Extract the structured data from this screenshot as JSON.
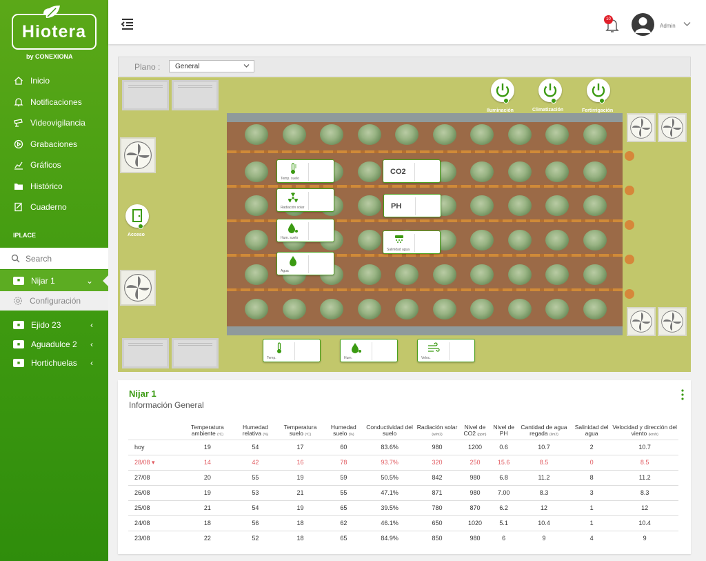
{
  "app": {
    "brand": "Hiotera",
    "byline": "by CONEXIONA"
  },
  "sidebar": {
    "nav": [
      {
        "label": "Inicio",
        "icon": "home-icon"
      },
      {
        "label": "Notificaciones",
        "icon": "bell-icon"
      },
      {
        "label": "Videovigilancia",
        "icon": "camera-icon"
      },
      {
        "label": "Grabaciones",
        "icon": "play-circle-icon"
      },
      {
        "label": "Gráficos",
        "icon": "chart-icon"
      },
      {
        "label": "Histórico",
        "icon": "folder-icon"
      },
      {
        "label": "Cuaderno",
        "icon": "notebook-icon"
      }
    ],
    "section_label": "IPLACE",
    "search_placeholder": "Search",
    "places": [
      {
        "label": "Nijar 1",
        "expanded": true
      },
      {
        "label": "Ejido 23"
      },
      {
        "label": "Aguadulce 2"
      },
      {
        "label": "Hortichuelas"
      }
    ],
    "sub_item": "Configuración"
  },
  "header": {
    "notifications_count": "10",
    "user": "Admin"
  },
  "plan": {
    "label": "Plano :",
    "selected": "General"
  },
  "greenhouse": {
    "power_buttons": [
      {
        "label": "Iluminación"
      },
      {
        "label": "Climatización"
      },
      {
        "label": "Fertirrigación"
      }
    ],
    "access_label": "Acceso",
    "sensors": [
      {
        "label": "Temp. suelo",
        "icon": "thermometer-icon"
      },
      {
        "label": "Radiación solar",
        "icon": "radiation-icon"
      },
      {
        "label": "Hum. suelo",
        "icon": "drop-icon"
      },
      {
        "label": "Agua",
        "icon": "drop-icon"
      },
      {
        "label": "CO2"
      },
      {
        "label": "PH"
      },
      {
        "label": "Salinidad agua",
        "icon": "salinity-icon"
      },
      {
        "label": "Temp.",
        "icon": "thermometer-icon"
      },
      {
        "label": "Hum.",
        "icon": "drop-icon"
      },
      {
        "label": "Veloc.",
        "icon": "wind-icon"
      }
    ],
    "colors": {
      "accent": "#3b9a12",
      "alert": "#e0585e"
    }
  },
  "card": {
    "title": "Nijar 1",
    "subtitle": "Información General",
    "columns": [
      {
        "label": "Temperatura ambiente",
        "unit": "(ºC)"
      },
      {
        "label": "Humedad relativa",
        "unit": "(%)"
      },
      {
        "label": "Temperatura suelo",
        "unit": "(ºC)"
      },
      {
        "label": "Humedad suelo",
        "unit": "(%)"
      },
      {
        "label": "Conductividad del suelo",
        "unit": ""
      },
      {
        "label": "Radiación solar",
        "unit": "(w/m2)"
      },
      {
        "label": "Nivel de CO2",
        "unit": "(ppm)"
      },
      {
        "label": "Nivel de PH",
        "unit": ""
      },
      {
        "label": "Cantidad de agua regada",
        "unit": "(l/m2)"
      },
      {
        "label": "Salinidad del agua",
        "unit": ""
      },
      {
        "label": "Velocidad y dirección del viento",
        "unit": "(km/h)"
      }
    ],
    "rows": [
      {
        "date": "hoy",
        "alert": false,
        "values": [
          "19",
          "54",
          "17",
          "60",
          "83.6%",
          "980",
          "1200",
          "0.6",
          "10.7",
          "2",
          "10.7"
        ]
      },
      {
        "date": "28/08",
        "alert": true,
        "values": [
          "14",
          "42",
          "16",
          "78",
          "93.7%",
          "320",
          "250",
          "15.6",
          "8.5",
          "0",
          "8.5"
        ]
      },
      {
        "date": "27/08",
        "alert": false,
        "values": [
          "20",
          "55",
          "19",
          "59",
          "50.5%",
          "842",
          "980",
          "6.8",
          "11.2",
          "8",
          "11.2"
        ]
      },
      {
        "date": "26/08",
        "alert": false,
        "values": [
          "19",
          "53",
          "21",
          "55",
          "47.1%",
          "871",
          "980",
          "7.00",
          "8.3",
          "3",
          "8.3"
        ]
      },
      {
        "date": "25/08",
        "alert": false,
        "values": [
          "21",
          "54",
          "19",
          "65",
          "39.5%",
          "780",
          "870",
          "6.2",
          "12",
          "1",
          "12"
        ]
      },
      {
        "date": "24/08",
        "alert": false,
        "values": [
          "18",
          "56",
          "18",
          "62",
          "46.1%",
          "650",
          "1020",
          "5.1",
          "10.4",
          "1",
          "10.4"
        ]
      },
      {
        "date": "23/08",
        "alert": false,
        "values": [
          "22",
          "52",
          "18",
          "65",
          "84.9%",
          "850",
          "980",
          "6",
          "9",
          "4",
          "9"
        ]
      }
    ]
  }
}
